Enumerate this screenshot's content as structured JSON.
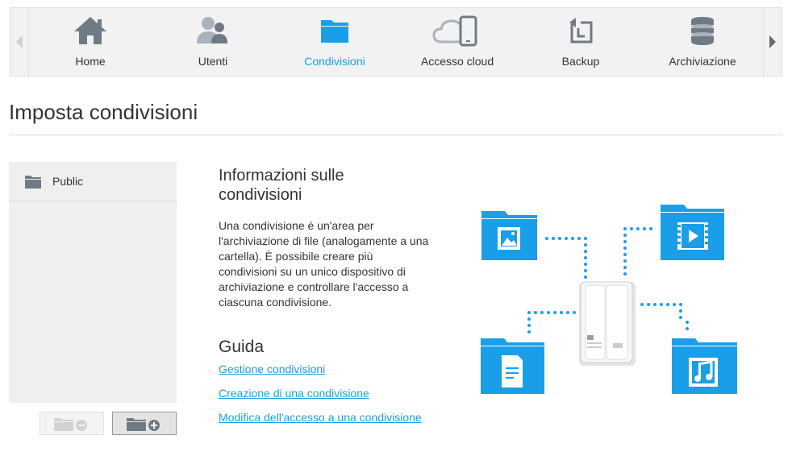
{
  "nav": {
    "items": [
      {
        "label": "Home",
        "icon": "home-icon"
      },
      {
        "label": "Utenti",
        "icon": "users-icon"
      },
      {
        "label": "Condivisioni",
        "icon": "folder-icon",
        "active": true
      },
      {
        "label": "Accesso cloud",
        "icon": "cloud-device-icon"
      },
      {
        "label": "Backup",
        "icon": "backup-icon"
      },
      {
        "label": "Archiviazione",
        "icon": "storage-icon"
      }
    ]
  },
  "page": {
    "title": "Imposta condivisioni"
  },
  "shares": {
    "items": [
      {
        "label": "Public",
        "icon": "folder-icon"
      }
    ],
    "remove_icon": "folder-remove-icon",
    "add_icon": "folder-add-icon"
  },
  "info": {
    "title": "Informazioni sulle condivisioni",
    "body": "Una condivisione è un'area per l'archiviazione di file (analogamente a una cartella). È possibile creare più condivisioni su un unico dispositivo di archiviazione e controllare l'accesso a ciascuna condivisione."
  },
  "guide": {
    "title": "Guida",
    "links": [
      "Gestione condivisioni",
      "Creazione di una condivisione",
      "Modifica dell'accesso a una condivisione"
    ]
  },
  "colors": {
    "accent": "#1b9ee8",
    "folder_blue": "#1a8fe3",
    "icon_gray": "#6f7a85"
  }
}
